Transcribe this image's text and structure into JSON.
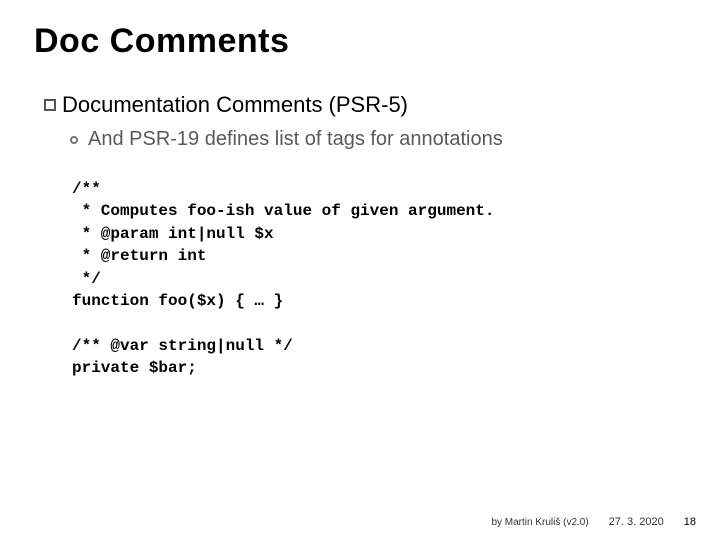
{
  "title": "Doc Comments",
  "bullet1": "Documentation Comments (PSR-5)",
  "bullet2": "And PSR-19 defines list of tags for annotations",
  "code": "/**\n * Computes foo-ish value of given argument.\n * @param int|null $x\n * @return int\n */\nfunction foo($x) { … }\n\n/** @var string|null */\nprivate $bar;",
  "footer": {
    "credit": "by Martin Kruliš (v2.0)",
    "date": "27. 3. 2020",
    "page": "18"
  }
}
